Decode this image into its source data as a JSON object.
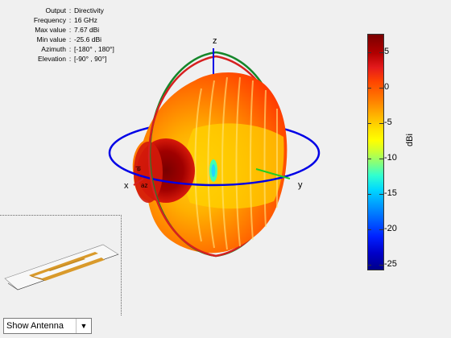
{
  "info": [
    {
      "key": "Output",
      "value": "Directivity"
    },
    {
      "key": "Frequency",
      "value": "16 GHz"
    },
    {
      "key": "Max value",
      "value": "7.67 dBi"
    },
    {
      "key": "Min value",
      "value": "-25.6 dBi"
    },
    {
      "key": "Azimuth",
      "value": "[-180° , 180°]"
    },
    {
      "key": "Elevation",
      "value": "[-90° , 90°]"
    }
  ],
  "info_sep": ":",
  "axes": {
    "x": "x",
    "y": "y",
    "z": "z",
    "az": "az",
    "el": "el"
  },
  "colorbar": {
    "label": "dBi",
    "ticks": [
      "5",
      "0",
      "-5",
      "-10",
      "-15",
      "-20",
      "-25"
    ],
    "min": -25.6,
    "max": 7.67
  },
  "dropdown": {
    "value": "Show Antenna"
  },
  "colors": {
    "azimuth_circle": "#0000e6",
    "elevation_circle_red": "#d62020",
    "elevation_circle_green": "#15862a"
  }
}
